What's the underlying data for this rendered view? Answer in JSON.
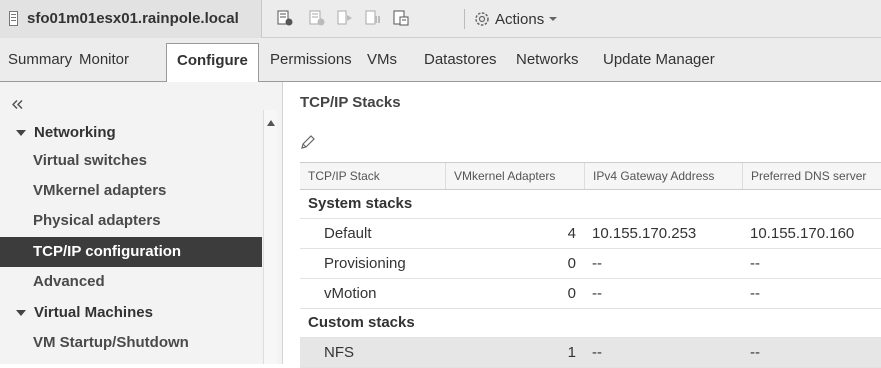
{
  "header": {
    "host_title": "sfo01m01esx01.rainpole.local",
    "toolbar_icons": [
      "host-actions-icon",
      "vm-icon",
      "power-on-icon",
      "suspend-icon",
      "migrate-icon"
    ],
    "actions_label": "Actions"
  },
  "tabs": [
    {
      "label": "Summary",
      "active": false
    },
    {
      "label": "Monitor",
      "active": false
    },
    {
      "label": "Configure",
      "active": true
    },
    {
      "label": "Permissions",
      "active": false
    },
    {
      "label": "VMs",
      "active": false
    },
    {
      "label": "Datastores",
      "active": false
    },
    {
      "label": "Networks",
      "active": false
    },
    {
      "label": "Update Manager",
      "active": false
    }
  ],
  "sidebar": {
    "collapse_glyph": "«",
    "groups": [
      {
        "label": "Networking",
        "items": [
          {
            "label": "Virtual switches"
          },
          {
            "label": "VMkernel adapters"
          },
          {
            "label": "Physical adapters"
          },
          {
            "label": "TCP/IP configuration",
            "selected": true
          },
          {
            "label": "Advanced"
          }
        ]
      },
      {
        "label": "Virtual Machines",
        "items": [
          {
            "label": "VM Startup/Shutdown"
          }
        ]
      }
    ]
  },
  "main": {
    "title": "TCP/IP Stacks",
    "columns": [
      "TCP/IP Stack",
      "VMkernel Adapters",
      "IPv4 Gateway Address",
      "Preferred DNS server"
    ],
    "groups": [
      {
        "label": "System stacks",
        "rows": [
          {
            "name": "Default",
            "adapters": "4",
            "gateway": "10.155.170.253",
            "dns": "10.155.170.160"
          },
          {
            "name": "Provisioning",
            "adapters": "0",
            "gateway": "--",
            "dns": "--"
          },
          {
            "name": "vMotion",
            "adapters": "0",
            "gateway": "--",
            "dns": "--"
          }
        ]
      },
      {
        "label": "Custom stacks",
        "rows": [
          {
            "name": "NFS",
            "adapters": "1",
            "gateway": "--",
            "dns": "--",
            "highlighted": true
          }
        ]
      }
    ]
  },
  "colors": {
    "selected_bg": "#3c3c3c",
    "header_bg": "#ececec",
    "highlight_row": "#e6e6e6"
  }
}
